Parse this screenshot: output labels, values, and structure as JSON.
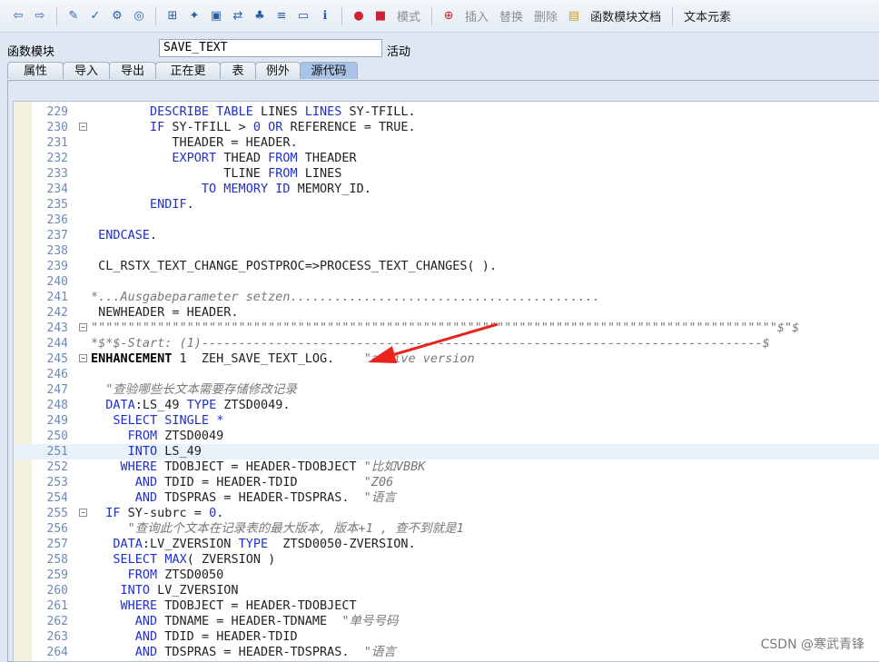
{
  "toolbar": {
    "items": [
      {
        "icon": "back-arrow-icon",
        "glyph": "⇦"
      },
      {
        "icon": "forward-arrow-icon",
        "glyph": "⇨"
      },
      {
        "icon": "pencil-glasses-icon",
        "glyph": "✎"
      },
      {
        "icon": "check-icon",
        "glyph": "✓"
      },
      {
        "icon": "activate-icon",
        "glyph": "⚙"
      },
      {
        "icon": "target-icon",
        "glyph": "◎"
      },
      {
        "icon": "hierarchy-icon",
        "glyph": "⊞"
      },
      {
        "icon": "wand-icon",
        "glyph": "✦"
      },
      {
        "icon": "monitor-icon",
        "glyph": "▣"
      },
      {
        "icon": "transfer-icon",
        "glyph": "⇄"
      },
      {
        "icon": "tree-icon",
        "glyph": "♣"
      },
      {
        "icon": "align-icon",
        "glyph": "≡"
      },
      {
        "icon": "frame-icon",
        "glyph": "▭"
      },
      {
        "icon": "info-icon",
        "glyph": "ℹ"
      },
      {
        "icon": "debug-icon",
        "glyph": "●"
      },
      {
        "icon": "stop-icon",
        "glyph": "■"
      }
    ],
    "mode_label": "模式",
    "insert_label": "插入",
    "replace_label": "替换",
    "delete_label": "删除",
    "docs_label": "函数模块文档",
    "text_elements_label": "文本元素"
  },
  "header": {
    "function_module_label": "函数模块",
    "function_module_value": "SAVE_TEXT",
    "status": "活动"
  },
  "tabs": [
    "属性",
    "导入",
    "导出",
    "正在更改",
    "表",
    "例外",
    "源代码"
  ],
  "active_tab": 6,
  "code_lines": [
    {
      "n": "229",
      "html": "        <span class='kw'>DESCRIBE TABLE</span> LINES <span class='kw'>LINES</span> SY-TFILL."
    },
    {
      "n": "230",
      "fold": true,
      "html": "        <span class='kw'>IF</span> SY-TFILL &gt; <span class='kw'>0</span> <span class='kw'>OR</span> REFERENCE = TRUE."
    },
    {
      "n": "231",
      "html": "           THEADER = HEADER."
    },
    {
      "n": "232",
      "html": "           <span class='kw'>EXPORT</span> THEAD <span class='kw'>FROM</span> THEADER"
    },
    {
      "n": "233",
      "html": "                  TLINE <span class='kw'>FROM</span> LINES"
    },
    {
      "n": "234",
      "html": "               <span class='kw'>TO MEMORY ID</span> MEMORY_ID."
    },
    {
      "n": "235",
      "html": "        <span class='kw'>ENDIF</span>."
    },
    {
      "n": "236",
      "html": ""
    },
    {
      "n": "237",
      "html": " <span class='kw'>ENDCASE</span>."
    },
    {
      "n": "238",
      "html": ""
    },
    {
      "n": "239",
      "html": " CL_RSTX_TEXT_CHANGE_POSTPROC=&gt;PROCESS_TEXT_CHANGES( )."
    },
    {
      "n": "240",
      "html": ""
    },
    {
      "n": "241",
      "html": "<span class='cm'>*...Ausgabeparameter setzen..........................................</span>"
    },
    {
      "n": "242",
      "html": " NEWHEADER = HEADER."
    },
    {
      "n": "243",
      "fold": true,
      "html": "<span class='cm'>\"\"\"\"\"\"\"\"\"\"\"\"\"\"\"\"\"\"\"\"\"\"\"\"\"\"\"\"\"\"\"\"\"\"\"\"\"\"\"\"\"\"\"\"\"\"\"\"\"\"\"\"\"\"\"\"\"\"\"\"\"\"\"\"\"\"\"\"\"\"\"\"\"\"\"\"\"\"\"\"\"\"\"\"\"\"\"\"\"\"\"\"\"$\"$</span>"
    },
    {
      "n": "244",
      "html": "<span class='cm'>*$*$-Start: (1)----------------------------------------------------------------------------$</span>"
    },
    {
      "n": "245",
      "fold": true,
      "html": "<span class='bold'>ENHANCEMENT</span> 1  ZEH_SAVE_TEXT_LOG.    <span class='cm'>\"active version</span>"
    },
    {
      "n": "246",
      "html": ""
    },
    {
      "n": "247",
      "html": "  <span class='cm'>\"查验哪些长文本需要存储修改记录</span>"
    },
    {
      "n": "248",
      "html": "  <span class='kw'>DATA</span>:LS_49 <span class='kw'>TYPE</span> ZTSD0049."
    },
    {
      "n": "249",
      "html": "   <span class='kw'>SELECT SINGLE</span> <span class='kw'>*</span>"
    },
    {
      "n": "250",
      "html": "     <span class='kw'>FROM</span> ZTSD0049"
    },
    {
      "n": "251",
      "hl": true,
      "html": "     <span class='kw'>INTO</span> LS_49"
    },
    {
      "n": "252",
      "html": "    <span class='kw'>WHERE</span> TDOBJECT = HEADER-TDOBJECT <span class='cm'>\"比如VBBK</span>"
    },
    {
      "n": "253",
      "html": "      <span class='kw'>AND</span> TDID = HEADER-TDID         <span class='cm'>\"Z06</span>"
    },
    {
      "n": "254",
      "html": "      <span class='kw'>AND</span> TDSPRAS = HEADER-TDSPRAS.  <span class='cm'>\"语言</span>"
    },
    {
      "n": "255",
      "fold": true,
      "html": "  <span class='kw'>IF</span> SY-subrc = <span class='kw'>0</span>."
    },
    {
      "n": "256",
      "html": "     <span class='cm'>\"查询此个文本在记录表的最大版本, 版本+1 , 查不到就是1</span>"
    },
    {
      "n": "257",
      "html": "   <span class='kw'>DATA</span>:LV_ZVERSION <span class='kw'>TYPE</span>  ZTSD0050-ZVERSION."
    },
    {
      "n": "258",
      "html": "   <span class='kw'>SELECT</span> <span class='kw'>MAX</span>( ZVERSION )"
    },
    {
      "n": "259",
      "html": "     <span class='kw'>FROM</span> ZTSD0050"
    },
    {
      "n": "260",
      "html": "    <span class='kw'>INTO</span> LV_ZVERSION"
    },
    {
      "n": "261",
      "html": "    <span class='kw'>WHERE</span> TDOBJECT = HEADER-TDOBJECT"
    },
    {
      "n": "262",
      "html": "      <span class='kw'>AND</span> TDNAME = HEADER-TDNAME  <span class='cm'>\"单号号码</span>"
    },
    {
      "n": "263",
      "html": "      <span class='kw'>AND</span> TDID = HEADER-TDID"
    },
    {
      "n": "264",
      "html": "      <span class='kw'>AND</span> TDSPRAS = HEADER-TDSPRAS.  <span class='cm'>\"语言</span>"
    }
  ],
  "watermark": "CSDN @寒武青锋",
  "colors": {
    "keyword": "#2030c8",
    "comment": "#777777",
    "arrow": "#e8241d"
  }
}
